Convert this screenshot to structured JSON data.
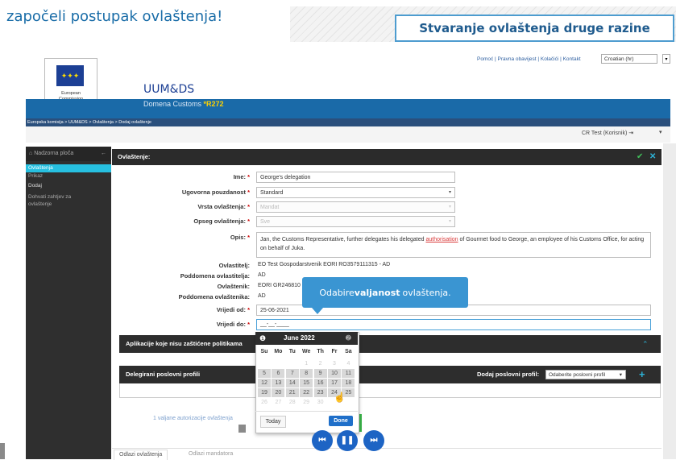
{
  "slide": {
    "top_text": "započeli postupak ovlaštenja!",
    "title_box": "Stvaranje ovlaštenja druge razine"
  },
  "header": {
    "top_links": "Pomoć | Pravna obavijest | Kolačići | Kontakt",
    "language": "Croatian (hr)",
    "logo_line1": "European",
    "logo_line2": "Commission",
    "brand": "UUM&DS",
    "domain_label": "Domena Customs",
    "domain_code": "*R272",
    "breadcrumb": "Europska komisija > UUM&DS > Ovlaštenja > Dodaj ovlaštenje",
    "user": "CR Test (Korisnik)"
  },
  "sidebar": {
    "home": "Nadzorna ploča",
    "items": [
      {
        "label": "Ovlaštenja"
      },
      {
        "label": "Prikaz"
      },
      {
        "label": "Dodaj"
      },
      {
        "label": "Dohvati zahtjev za"
      },
      {
        "label": "ovlaštenje"
      }
    ]
  },
  "main": {
    "title": "Ovlaštenje:",
    "required_mark": "*",
    "fields": {
      "ime_label": "Ime:",
      "ime_value": "George's delegation",
      "ugovorna_label": "Ugovorna pouzdanost",
      "ugovorna_value": "Standard",
      "vrsta_label": "Vrsta ovlaštenja:",
      "vrsta_value": "Mandat",
      "opseg_label": "Opseg ovlaštenja:",
      "opseg_value": "Sve",
      "opis_label": "Opis:",
      "opis_pre": "Jan, the Customs Representative, further delegates his delegated ",
      "opis_link": "authorisation",
      "opis_post": " of Gourmet food to George, an employee of his Customs Office, for acting on behalf of Juka.",
      "ovlastitelj_label": "Ovlastitelj:",
      "ovlastitelj_value": "EO Test Gospodarstvenik EORI RO3579111315 - AD",
      "poddomena_ovlastitelja_label": "Poddomena ovlastitelja:",
      "poddomena_ovlastitelja_value": "AD",
      "ovlastenik_label": "Ovlaštenik:",
      "ovlastenik_value": "EORI GR246810",
      "poddomena_ovlastenika_label": "Poddomena ovlaštenika:",
      "poddomena_ovlastenika_value": "AD",
      "vrijedi_od_label": "Vrijedi od:",
      "vrijedi_od_value": "25-06-2021",
      "vrijedi_do_label": "Vrijedi do:",
      "vrijedi_do_value": "__-__-____"
    },
    "section1_title": "Aplikacije koje nisu zaštićene politikama",
    "section2_title": "Delegirani poslovni profili",
    "section2_add_label": "Dodaj poslovni profil:",
    "section2_select": "Odaberite poslovni profil",
    "valid_link": "1 valjane autorizacije ovlaštenja",
    "bottom_tabs": [
      "Odlazi ovlaštenja",
      "Odlazi mandatora"
    ]
  },
  "tooltip": {
    "pre": "Odabire ",
    "bold": "valjanost",
    "post": " ovlaštenja."
  },
  "datepicker": {
    "month": "June 2022",
    "weekdays": [
      "Su",
      "Mo",
      "Tu",
      "We",
      "Th",
      "Fr",
      "Sa"
    ],
    "rows": [
      [
        "",
        "",
        "",
        "1",
        "2",
        "3",
        "4"
      ],
      [
        "5",
        "6",
        "7",
        "8",
        "9",
        "10",
        "11"
      ],
      [
        "12",
        "13",
        "14",
        "15",
        "16",
        "17",
        "18"
      ],
      [
        "19",
        "20",
        "21",
        "22",
        "23",
        "24",
        "25"
      ],
      [
        "26",
        "27",
        "28",
        "29",
        "30",
        "",
        ""
      ]
    ],
    "today_label": "Today",
    "done_label": "Done"
  },
  "colors": {
    "accent_blue": "#1a6aa8",
    "cyan": "#27c0e0",
    "tooltip_blue": "#3a95d2",
    "done_blue": "#1f6fc9"
  }
}
